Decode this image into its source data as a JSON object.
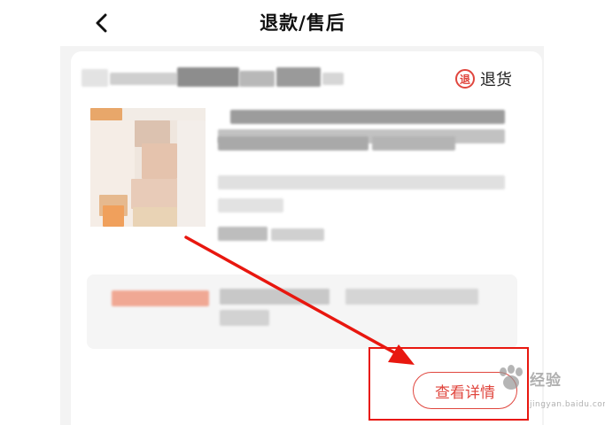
{
  "header": {
    "title": "退款/售后",
    "back_icon": "chevron-left-icon"
  },
  "order": {
    "badge_glyph": "退",
    "badge_label": "退货",
    "detail_button_label": "查看详情"
  },
  "watermark": {
    "text": "经验",
    "sub": "jingyan.baidu.com",
    "icon": "paw-icon"
  },
  "colors": {
    "accent": "#e0463e",
    "annotation": "#e8170f",
    "panel_bg": "#f3f3f3"
  }
}
